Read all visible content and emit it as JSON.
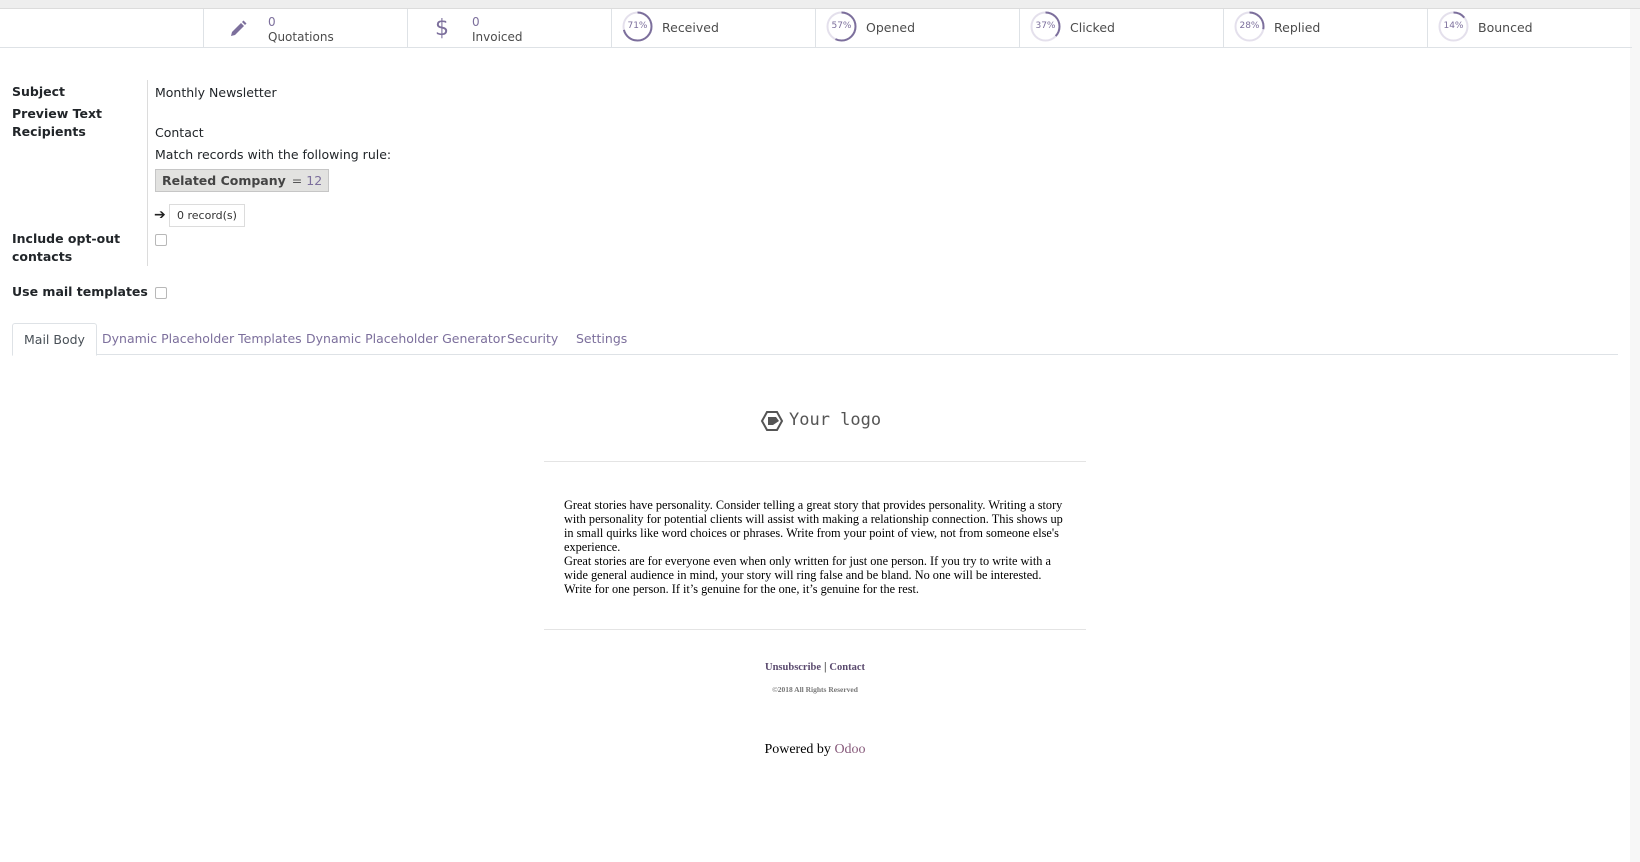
{
  "smart_buttons": [
    {
      "icon": "pencil-icon",
      "count": "0",
      "label": "Quotations"
    },
    {
      "icon": "dollar-icon",
      "count": "0",
      "label": "Invoiced"
    }
  ],
  "stats": [
    {
      "percent": "71%",
      "label": "Received",
      "value": 0.71
    },
    {
      "percent": "57%",
      "label": "Opened",
      "value": 0.57
    },
    {
      "percent": "37%",
      "label": "Clicked",
      "value": 0.37
    },
    {
      "percent": "28%",
      "label": "Replied",
      "value": 0.28
    },
    {
      "percent": "14%",
      "label": "Bounced",
      "value": 0.14
    }
  ],
  "form": {
    "subject_label": "Subject",
    "subject_value": "Monthly Newsletter",
    "preview_label": "Preview Text",
    "recipients_label": "Recipients",
    "recipients_value": "Contact",
    "rule_text": "Match records with the following rule:",
    "rule_field": "Related Company",
    "rule_op": "=",
    "rule_value": "12",
    "records_text": "0 record(s)",
    "optout_label_1": "Include opt-out",
    "optout_label_2": "contacts",
    "optout_checked": false,
    "templates_label": "Use mail templates",
    "templates_checked": false
  },
  "tabs": [
    {
      "label": "Mail Body",
      "active": true
    },
    {
      "label": "Dynamic Placeholder Templates",
      "active": false
    },
    {
      "label": "Dynamic Placeholder Generator",
      "active": false
    },
    {
      "label": "Security",
      "active": false
    },
    {
      "label": "Settings",
      "active": false
    }
  ],
  "mail": {
    "logo_text": "Your logo",
    "paragraph_1": "Great stories have personality. Consider telling a great story that provides personality. Writing a story with personality for potential clients will assist with making a relationship connection. This shows up in small quirks like word choices or phrases. Write from your point of view, not from someone else's experience.",
    "paragraph_2": "Great stories are for everyone even when only written for just one person. If you try to write with a wide general audience in mind, your story will ring false and be bland. No one will be interested. Write for one person. If it’s genuine for the one, it’s genuine for the rest.",
    "unsubscribe": "Unsubscribe",
    "separator": "|",
    "contact": "Contact",
    "copyright": "©2018 All Rights Reserved",
    "powered_by": "Powered by",
    "brand": "Odoo"
  },
  "colors": {
    "accent": "#7c6f9c",
    "brand": "#875a7b"
  }
}
